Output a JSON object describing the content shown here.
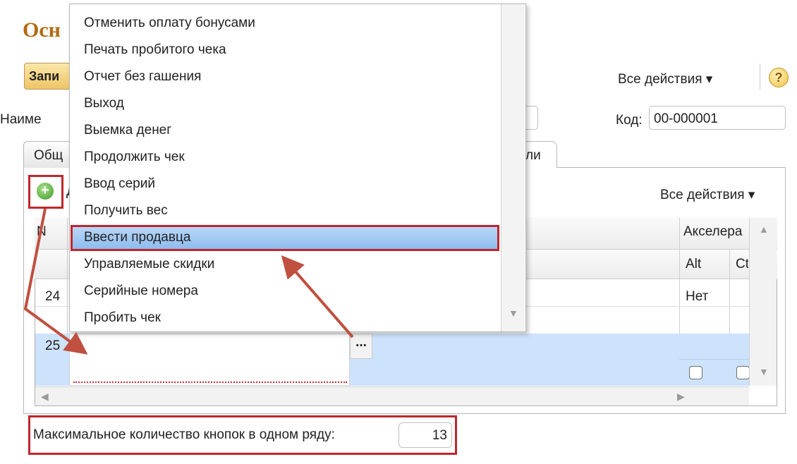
{
  "window": {
    "title": "Осн",
    "write_button": "Запи",
    "all_actions": "Все действия ▾",
    "help": "?"
  },
  "fields": {
    "name_label": "Наиме",
    "code_label": "Код:",
    "code_value": "00-000001"
  },
  "tabs": [
    {
      "label": "Общ"
    },
    {
      "label": "ли"
    }
  ],
  "table": {
    "add_label": "Д",
    "all_actions": "Все действия ▾",
    "col_n": "N",
    "col_accel": "Акселера",
    "col_alt": "Alt",
    "col_ctrl": "Ct",
    "rows": [
      {
        "n": "24",
        "alt": "Нет"
      },
      {
        "n": "25"
      }
    ],
    "ellipsis": "..."
  },
  "popup_menu": {
    "items": [
      "Отменить оплату бонусами",
      "Печать пробитого чека",
      "Отчет без гашения",
      "Выход",
      "Выемка денег",
      "Продолжить чек",
      "Ввод серий",
      "Получить вес",
      "Ввести продавца",
      "Управляемые скидки",
      "Серийные номера",
      "Пробить чек"
    ],
    "selected_index": 8
  },
  "bottom": {
    "max_buttons_label": "Максимальное количество кнопок в одном ряду:",
    "max_buttons_value": "13"
  },
  "colors": {
    "highlight_border": "#c0262d",
    "selection": "#8dbcef",
    "row_selected": "#cde2fb",
    "title": "#b26a10"
  },
  "icons": [
    "add-icon",
    "help-icon",
    "ellipsis-icon",
    "scroll-arrow-icon"
  ]
}
